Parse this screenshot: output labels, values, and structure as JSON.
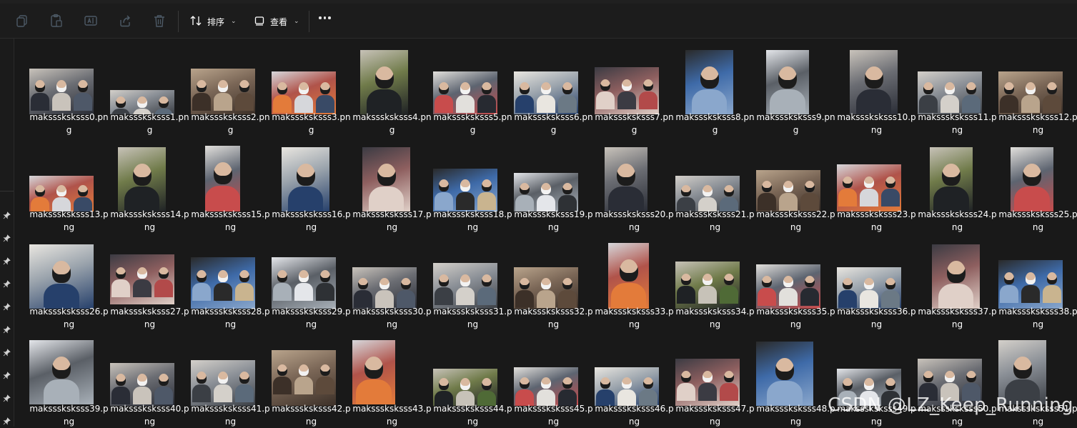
{
  "toolbar": {
    "copy_icon": "copy-icon",
    "paste_icon": "paste-icon",
    "rename_icon": "rename-icon",
    "share_icon": "share-icon",
    "delete_icon": "trash-icon",
    "sort_label": "排序",
    "view_label": "查看",
    "more_icon": "more-icon"
  },
  "files": [
    {
      "name": "maksssksksss0.png"
    },
    {
      "name": "maksssksksss1.png"
    },
    {
      "name": "maksssksksss2.png"
    },
    {
      "name": "maksssksksss3.png"
    },
    {
      "name": "maksssksksss4.png"
    },
    {
      "name": "maksssksksss5.png"
    },
    {
      "name": "maksssksksss6.png"
    },
    {
      "name": "maksssksksss7.png"
    },
    {
      "name": "maksssksksss8.png"
    },
    {
      "name": "maksssksksss9.png"
    },
    {
      "name": "maksssksksss10.png"
    },
    {
      "name": "maksssksksss11.png"
    },
    {
      "name": "maksssksksss12.png"
    },
    {
      "name": "maksssksksss13.png"
    },
    {
      "name": "maksssksksss14.png"
    },
    {
      "name": "maksssksksss15.png"
    },
    {
      "name": "maksssksksss16.png"
    },
    {
      "name": "maksssksksss17.png"
    },
    {
      "name": "maksssksksss18.png"
    },
    {
      "name": "maksssksksss19.png"
    },
    {
      "name": "maksssksksss20.png"
    },
    {
      "name": "maksssksksss21.png"
    },
    {
      "name": "maksssksksss22.png"
    },
    {
      "name": "maksssksksss23.png"
    },
    {
      "name": "maksssksksss24.png"
    },
    {
      "name": "maksssksksss25.png"
    },
    {
      "name": "maksssksksss26.png"
    },
    {
      "name": "maksssksksss27.png"
    },
    {
      "name": "maksssksksss28.png"
    },
    {
      "name": "maksssksksss29.png"
    },
    {
      "name": "maksssksksss30.png"
    },
    {
      "name": "maksssksksss31.png"
    },
    {
      "name": "maksssksksss32.png"
    },
    {
      "name": "maksssksksss33.png"
    },
    {
      "name": "maksssksksss34.png"
    },
    {
      "name": "maksssksksss35.png"
    },
    {
      "name": "maksssksksss36.png"
    },
    {
      "name": "maksssksksss37.png"
    },
    {
      "name": "maksssksksss38.png"
    },
    {
      "name": "maksssksksss39.png"
    },
    {
      "name": "maksssksksss40.png"
    },
    {
      "name": "maksssksksss41.png"
    },
    {
      "name": "maksssksksss42.png"
    },
    {
      "name": "maksssksksss43.png"
    },
    {
      "name": "maksssksksss44.png"
    },
    {
      "name": "maksssksksss45.png"
    },
    {
      "name": "maksssksksss46.png"
    },
    {
      "name": "maksssksksss47.png"
    },
    {
      "name": "maksssksksss48.png"
    },
    {
      "name": "maksssksksss49.png"
    },
    {
      "name": "maksssksksss50.png"
    },
    {
      "name": "maksssksksss51.png"
    }
  ],
  "watermark": "CSDN @LZ_Keep_Running"
}
